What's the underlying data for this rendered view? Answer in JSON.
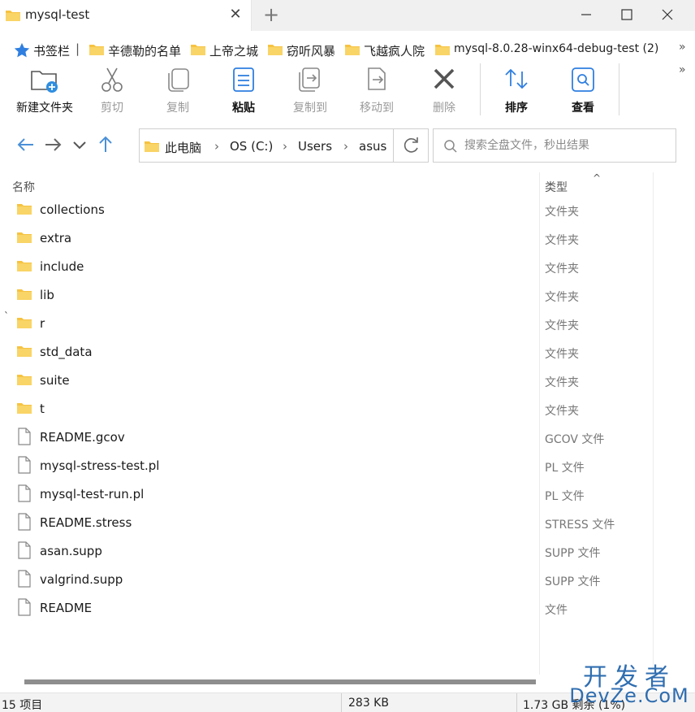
{
  "window": {
    "tab_title": "mysql-test",
    "new_tab_symbol": "+",
    "close_symbol": "✕"
  },
  "bookmarks": {
    "bar_label": "书签栏",
    "separator": "|",
    "items": [
      {
        "label": "辛德勒的名单"
      },
      {
        "label": "上帝之城"
      },
      {
        "label": "窃听风暴"
      },
      {
        "label": "飞越疯人院"
      },
      {
        "label": "mysql-8.0.28-winx64-debug-test (2)"
      }
    ],
    "more": "»"
  },
  "toolbar": {
    "new_folder": "新建文件夹",
    "cut": "剪切",
    "copy": "复制",
    "paste": "粘贴",
    "copy_to": "复制到",
    "move_to": "移动到",
    "delete": "删除",
    "sort": "排序",
    "view": "查看",
    "more": "»"
  },
  "navigation": {
    "breadcrumbs": [
      "此电脑",
      "OS (C:)",
      "Users",
      "asus"
    ],
    "crumb_sep": "›",
    "search_placeholder": "搜索全盘文件，秒出结果"
  },
  "file_list": {
    "col_name": "名称",
    "col_type": "类型",
    "sort_caret": "^",
    "stray_mark": "`",
    "rows": [
      {
        "name": "collections",
        "type": "文件夹",
        "kind": "folder"
      },
      {
        "name": "extra",
        "type": "文件夹",
        "kind": "folder"
      },
      {
        "name": "include",
        "type": "文件夹",
        "kind": "folder"
      },
      {
        "name": "lib",
        "type": "文件夹",
        "kind": "folder"
      },
      {
        "name": "r",
        "type": "文件夹",
        "kind": "folder"
      },
      {
        "name": "std_data",
        "type": "文件夹",
        "kind": "folder"
      },
      {
        "name": "suite",
        "type": "文件夹",
        "kind": "folder"
      },
      {
        "name": "t",
        "type": "文件夹",
        "kind": "folder"
      },
      {
        "name": "README.gcov",
        "type": "GCOV 文件",
        "kind": "file"
      },
      {
        "name": "mysql-stress-test.pl",
        "type": "PL 文件",
        "kind": "file"
      },
      {
        "name": "mysql-test-run.pl",
        "type": "PL 文件",
        "kind": "file"
      },
      {
        "name": "README.stress",
        "type": "STRESS 文件",
        "kind": "file"
      },
      {
        "name": "asan.supp",
        "type": "SUPP 文件",
        "kind": "file"
      },
      {
        "name": "valgrind.supp",
        "type": "SUPP 文件",
        "kind": "file"
      },
      {
        "name": "README",
        "type": "文件",
        "kind": "file"
      }
    ]
  },
  "status": {
    "item_count": "15 项目",
    "size": "283 KB",
    "free": "1.73 GB 剩余 (1%)"
  },
  "watermark": {
    "cn": "开发者",
    "en": "DevZe.CoM"
  },
  "colors": {
    "folder": "#f6c342",
    "accent": "#4a90d9",
    "disabled_text": "#9a9a9a"
  }
}
